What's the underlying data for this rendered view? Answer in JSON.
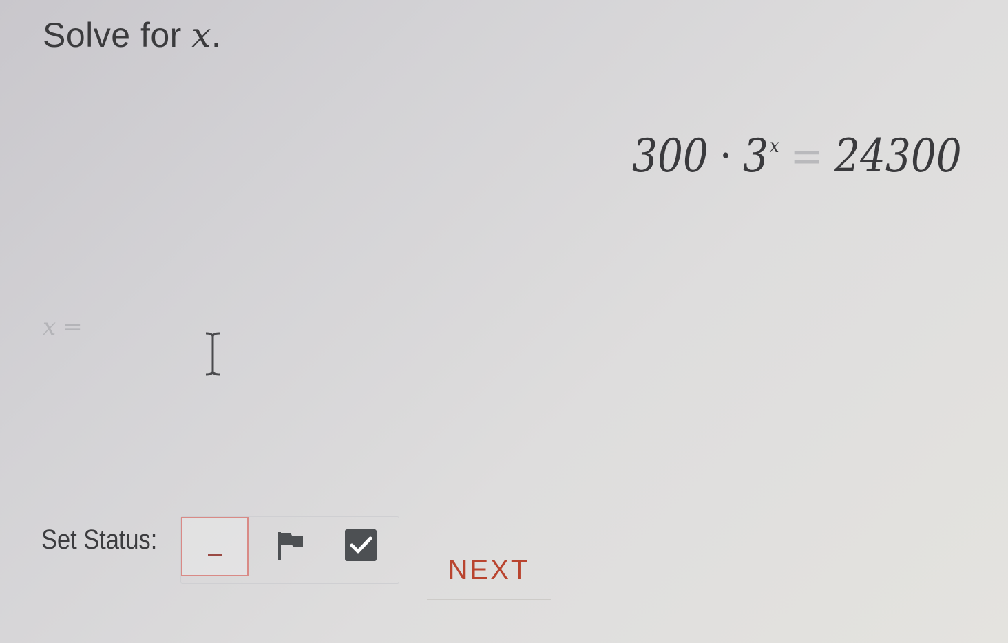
{
  "question": {
    "prompt_prefix": "Solve for ",
    "prompt_variable": "x",
    "prompt_suffix": ".",
    "equation": {
      "coefficient": "300",
      "operator": "·",
      "base": "3",
      "exponent": "x",
      "equals": "=",
      "result": "24300"
    }
  },
  "answer": {
    "label_variable": "x",
    "label_equals": "=",
    "value": ""
  },
  "status": {
    "label": "Set Status:",
    "unanswered_icon": "dash-icon",
    "flag_icon": "flag-icon",
    "done_icon": "checkbox-checked-icon",
    "accent_color": "#d98a86",
    "done_color": "#4d5053"
  },
  "navigation": {
    "next_label": "NEXT",
    "next_color": "#b9442f"
  }
}
